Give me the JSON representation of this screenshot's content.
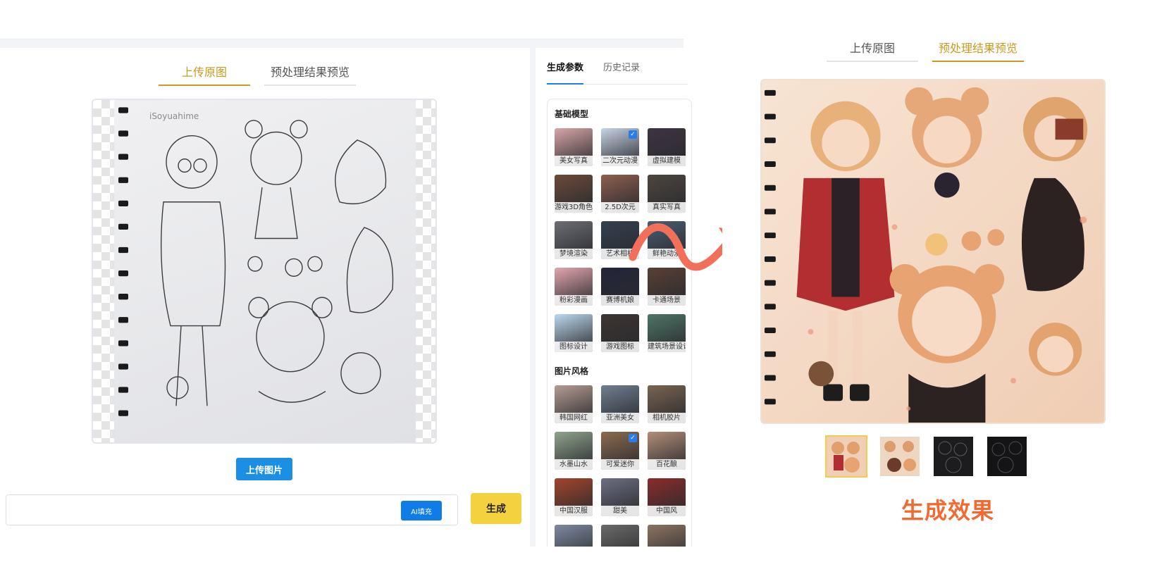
{
  "left_panel": {
    "tabs": [
      {
        "label": "上传原图",
        "active": true
      },
      {
        "label": "预处理结果预览",
        "active": false
      }
    ],
    "sketch_watermark": "iSoyuahime",
    "upload_button": "上传图片",
    "prompt": {
      "value": "",
      "placeholder": ""
    },
    "ai_fill_button": "AI填充",
    "generate_button": "生成"
  },
  "sidebar": {
    "tabs": [
      {
        "label": "生成参数",
        "active": true
      },
      {
        "label": "历史记录",
        "active": false
      }
    ],
    "sections": [
      {
        "title": "基础模型",
        "items": [
          {
            "label": "美女写真",
            "color": "#d9a6a8",
            "selected": false
          },
          {
            "label": "二次元动漫",
            "color": "#c7d3e6",
            "selected": true
          },
          {
            "label": "虚拟建模",
            "color": "#3e3442",
            "selected": false
          },
          {
            "label": "游戏3D角色",
            "color": "#6b4a3a",
            "selected": false
          },
          {
            "label": "2.5D次元",
            "color": "#8e5f4f",
            "selected": false
          },
          {
            "label": "真实写真",
            "color": "#4d463f",
            "selected": false
          },
          {
            "label": "梦境渲染",
            "color": "#6c6e74",
            "selected": false
          },
          {
            "label": "艺术相机",
            "color": "#34404f",
            "selected": false
          },
          {
            "label": "鲜艳动漫",
            "color": "#4a5e73",
            "selected": false
          },
          {
            "label": "粉彩漫画",
            "color": "#e2a6ae",
            "selected": false
          },
          {
            "label": "赛博机娘",
            "color": "#23253a",
            "selected": false
          },
          {
            "label": "卡通场景",
            "color": "#5a4034",
            "selected": false
          },
          {
            "label": "图标设计",
            "color": "#bcd8ee",
            "selected": false
          },
          {
            "label": "游戏图标",
            "color": "#3c3532",
            "selected": false
          },
          {
            "label": "建筑场景设计",
            "color": "#4e7566",
            "selected": false
          }
        ]
      },
      {
        "title": "图片风格",
        "items": [
          {
            "label": "韩国网红",
            "color": "#b59d92",
            "selected": false
          },
          {
            "label": "亚洲美女",
            "color": "#6f7f92",
            "selected": false
          },
          {
            "label": "相机胶片",
            "color": "#7a6450",
            "selected": false
          },
          {
            "label": "水墨山水",
            "color": "#8fa38e",
            "selected": false
          },
          {
            "label": "可爱迷你",
            "color": "#8c6b4f",
            "selected": true
          },
          {
            "label": "百花酿",
            "color": "#b28e77",
            "selected": false
          },
          {
            "label": "中国汉服",
            "color": "#a3452c",
            "selected": false
          },
          {
            "label": "甜美",
            "color": "#6d6e83",
            "selected": false
          },
          {
            "label": "中国风",
            "color": "#8a2c2a",
            "selected": false
          },
          {
            "label": "",
            "color": "#7d8aa0",
            "selected": false
          },
          {
            "label": "",
            "color": "#6a6a6a",
            "selected": false
          },
          {
            "label": "",
            "color": "#8c7461",
            "selected": false
          }
        ]
      }
    ]
  },
  "right_panel": {
    "tabs": [
      {
        "label": "上传原图",
        "active": false
      },
      {
        "label": "预处理结果预览",
        "active": true
      }
    ],
    "result_thumbs": [
      {
        "name": "result-1",
        "selected": true
      },
      {
        "name": "result-2",
        "selected": false
      },
      {
        "name": "result-3",
        "selected": false
      },
      {
        "name": "result-4",
        "selected": false
      }
    ],
    "caption": "生成效果"
  }
}
